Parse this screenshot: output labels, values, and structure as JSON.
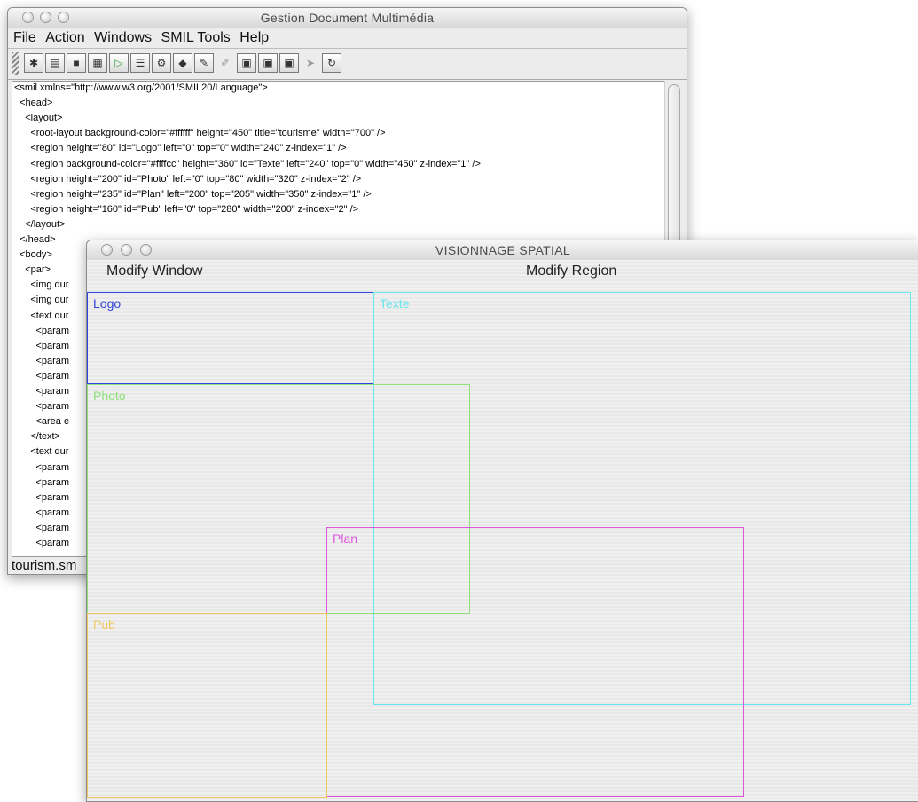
{
  "editor": {
    "title": "Gestion Document Multimédia",
    "menu": [
      "File",
      "Action",
      "Windows",
      "SMIL Tools",
      "Help"
    ],
    "toolbar": [
      "new-icon",
      "open-icon",
      "save-icon",
      "save-all-icon",
      "play-icon",
      "tree-icon",
      "settings-icon",
      "region-icon",
      "edit-icon",
      "brush-icon",
      "layout-icon",
      "layout2-icon",
      "layout3-icon",
      "pointer-icon",
      "refresh-icon"
    ],
    "code_lines": [
      "<smil xmlns=\"http://www.w3.org/2001/SMIL20/Language\">",
      "  <head>",
      "    <layout>",
      "      <root-layout background-color=\"#ffffff\" height=\"450\" title=\"tourisme\" width=\"700\" />",
      "      <region height=\"80\" id=\"Logo\" left=\"0\" top=\"0\" width=\"240\" z-index=\"1\" />",
      "      <region background-color=\"#ffffcc\" height=\"360\" id=\"Texte\" left=\"240\" top=\"0\" width=\"450\" z-index=\"1\" />",
      "      <region height=\"200\" id=\"Photo\" left=\"0\" top=\"80\" width=\"320\" z-index=\"2\" />",
      "      <region height=\"235\" id=\"Plan\" left=\"200\" top=\"205\" width=\"350\" z-index=\"1\" />",
      "      <region height=\"160\" id=\"Pub\" left=\"0\" top=\"280\" width=\"200\" z-index=\"2\" />",
      "    </layout>",
      "  </head>",
      "  <body>",
      "    <par>",
      "      <img dur",
      "      <img dur",
      "      <text dur",
      "        <param",
      "        <param",
      "        <param",
      "        <param",
      "        <param",
      "        <param",
      "        <area e",
      "      </text>",
      "      <text dur",
      "        <param",
      "        <param",
      "        <param",
      "        <param",
      "        <param",
      "        <param"
    ],
    "status": "tourism.sm"
  },
  "viewer": {
    "title": "VISIONNAGE SPATIAL",
    "modify_window": "Modify Window",
    "modify_region": "Modify Region",
    "regions": [
      {
        "name": "Logo",
        "color": "#3344dd"
      },
      {
        "name": "Texte",
        "color": "#66e6ee"
      },
      {
        "name": "Photo",
        "color": "#8ee07a"
      },
      {
        "name": "Plan",
        "color": "#dd55dd"
      },
      {
        "name": "Pub",
        "color": "#f0c860"
      }
    ]
  }
}
